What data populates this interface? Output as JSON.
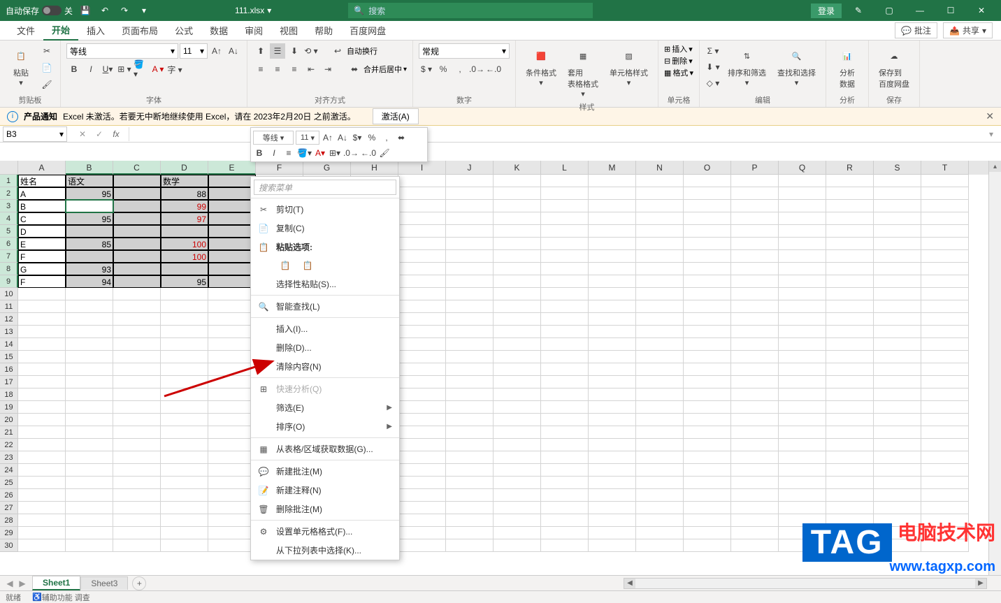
{
  "titlebar": {
    "autosave_label": "自动保存",
    "autosave_state": "关",
    "filename": "111.xlsx",
    "search_placeholder": "搜索",
    "login": "登录"
  },
  "tabs": {
    "file": "文件",
    "home": "开始",
    "insert": "插入",
    "layout": "页面布局",
    "formulas": "公式",
    "data": "数据",
    "review": "审阅",
    "view": "视图",
    "help": "帮助",
    "baidu": "百度网盘",
    "comment": "批注",
    "share": "共享"
  },
  "ribbon": {
    "clipboard": {
      "paste": "粘贴",
      "label": "剪贴板"
    },
    "font": {
      "name": "等线",
      "size": "11",
      "label": "字体"
    },
    "align": {
      "wrap": "自动换行",
      "merge": "合并后居中",
      "label": "对齐方式"
    },
    "number": {
      "format": "常规",
      "label": "数字"
    },
    "styles": {
      "cond": "条件格式",
      "table": "套用\n表格格式",
      "cell": "单元格样式",
      "label": "样式"
    },
    "cells": {
      "insert": "插入",
      "delete": "删除",
      "format": "格式",
      "label": "单元格"
    },
    "editing": {
      "sort": "排序和筛选",
      "find": "查找和选择",
      "label": "编辑"
    },
    "analysis": {
      "analyze": "分析\n数据",
      "label": "分析"
    },
    "save": {
      "baidu": "保存到\n百度网盘",
      "label": "保存"
    }
  },
  "notice": {
    "title": "产品通知",
    "message": "Excel 未激活。若要无中断地继续使用 Excel，请在 2023年2月20日 之前激活。",
    "activate": "激活(A)"
  },
  "formula_bar": {
    "name_box": "B3",
    "value": ""
  },
  "mini_toolbar": {
    "font": "等线",
    "size": "11"
  },
  "columns": [
    "A",
    "B",
    "C",
    "D",
    "E",
    "F",
    "G",
    "H",
    "I",
    "J",
    "K",
    "L",
    "M",
    "N",
    "O",
    "P",
    "Q",
    "R",
    "S",
    "T"
  ],
  "grid": {
    "headers": {
      "name": "姓名",
      "chinese": "语文",
      "math": "数学"
    },
    "rows": [
      {
        "name": "A",
        "chinese": "95",
        "math": "88",
        "math_red": false
      },
      {
        "name": "B",
        "chinese": "",
        "math": "99",
        "math_red": true
      },
      {
        "name": "C",
        "chinese": "95",
        "math": "97",
        "math_red": true
      },
      {
        "name": "D",
        "chinese": "",
        "math": "",
        "math_red": false
      },
      {
        "name": "E",
        "chinese": "85",
        "math": "100",
        "math_red": true
      },
      {
        "name": "F",
        "chinese": "",
        "math": "100",
        "math_red": true
      },
      {
        "name": "G",
        "chinese": "93",
        "math": "",
        "math_red": false
      },
      {
        "name": "F",
        "chinese": "94",
        "math": "95",
        "math_red": false
      }
    ]
  },
  "context_menu": {
    "search": "搜索菜单",
    "cut": "剪切(T)",
    "copy": "复制(C)",
    "paste_options": "粘贴选项:",
    "paste_special": "选择性粘贴(S)...",
    "smart_lookup": "智能查找(L)",
    "insert": "插入(I)...",
    "delete": "删除(D)...",
    "clear": "清除内容(N)",
    "quick_analysis": "快速分析(Q)",
    "filter": "筛选(E)",
    "sort": "排序(O)",
    "get_data": "从表格/区域获取数据(G)...",
    "new_comment": "新建批注(M)",
    "new_note": "新建注释(N)",
    "delete_comment": "删除批注(M)",
    "format_cells": "设置单元格格式(F)...",
    "pick_from_list": "从下拉列表中选择(K)..."
  },
  "sheets": {
    "sheet1": "Sheet1",
    "sheet3": "Sheet3"
  },
  "status": {
    "ready": "就绪",
    "access": "辅助功能 调查"
  },
  "watermark": {
    "tag": "TAG",
    "cn": "电脑技术网",
    "url": "www.tagxp.com"
  }
}
